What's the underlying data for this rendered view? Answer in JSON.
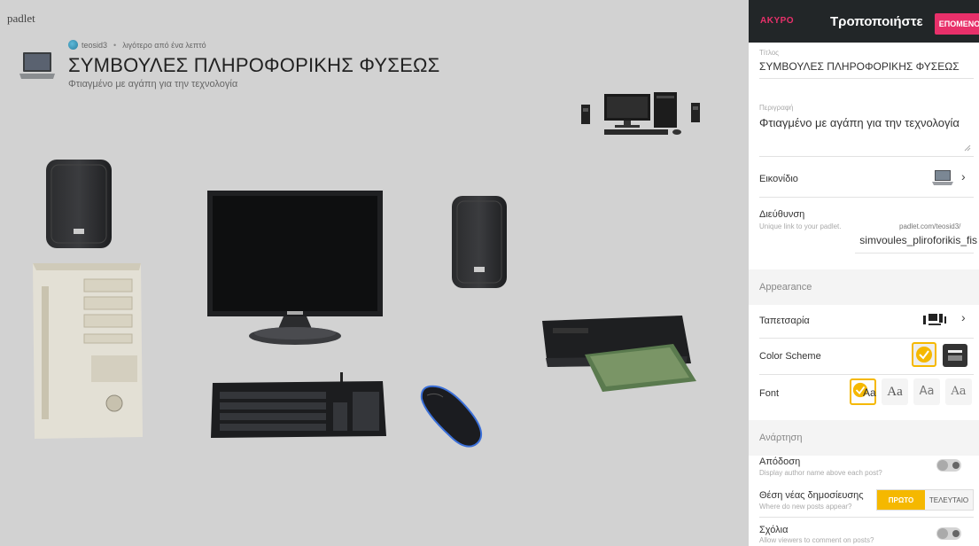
{
  "wall": {
    "brand": "padlet",
    "author": "teosid3",
    "time": "λιγότερο από ένα λεπτό",
    "title": "ΣΥΜΒΟΥΛΕΣ ΠΛΗΡΟΦΟΡΙΚΗΣ ΦΥΣΕΩΣ",
    "description": "Φτιαγμένο με αγάπη για την τεχνολογία"
  },
  "panel": {
    "cancel": "ΑΚΥΡΟ",
    "title": "Τροποποιήστε",
    "next": "ΕΠΟΜΕΝΟ",
    "title_label": "Τίτλος",
    "title_value": "ΣΥΜΒΟΥΛΕΣ ΠΛΗΡΟΦΟΡΙΚΗΣ ΦΥΣΕΩΣ",
    "desc_label": "Περιγραφή",
    "desc_value": "Φτιαγμένο με αγάπη για την τεχνολογία",
    "icon_label": "Εικονίδιο",
    "address_label": "Διεύθυνση",
    "address_hint": "Unique link to your padlet.",
    "address_prefix": "padlet.com/teosid3/",
    "address_value": "simvoules_pliroforikis_fis",
    "appearance": "Appearance",
    "wallpaper_label": "Ταπετσαρία",
    "color_scheme_label": "Color Scheme",
    "font_label": "Font",
    "font_samples": [
      "Aa",
      "Aa",
      "Aa",
      "Aa"
    ],
    "posting": "Ανάρτηση",
    "attribution_label": "Απόδοση",
    "attribution_hint": "Display author name above each post?",
    "new_post_label": "Θέση νέας δημοσίευσης",
    "new_post_hint": "Where do new posts appear?",
    "first": "ΠΡΩΤΟ",
    "last": "ΤΕΛΕΥΤΑΙΟ",
    "comments_label": "Σχόλια",
    "comments_hint": "Allow viewers to comment on posts?"
  },
  "colors": {
    "accent_pink": "#e8306a",
    "accent_yellow": "#f5b800",
    "header_dark": "#222628"
  },
  "icons": [
    "laptop-icon",
    "chevron-right-icon",
    "check-icon",
    "resize-handle-icon"
  ]
}
